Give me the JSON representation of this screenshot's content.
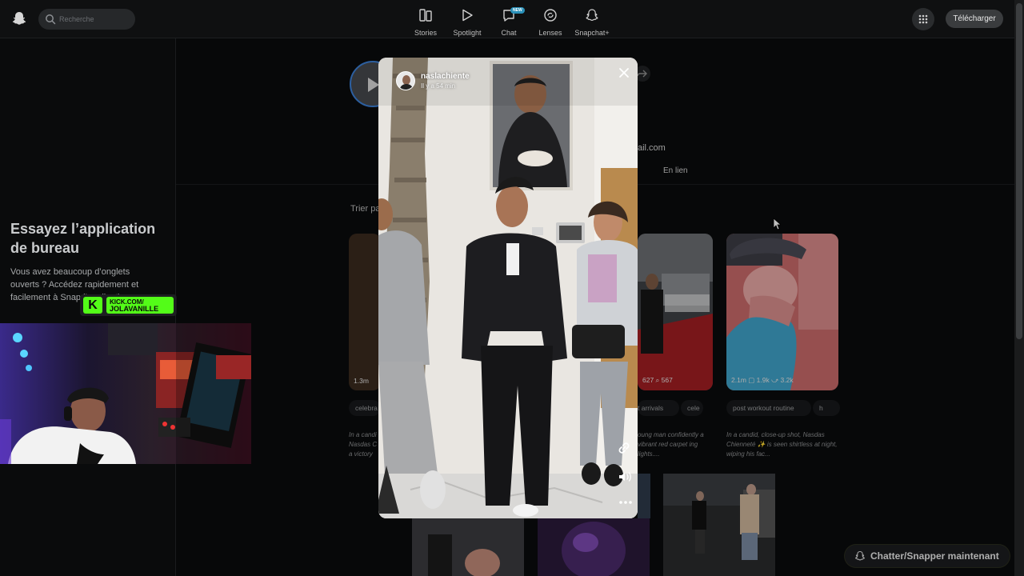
{
  "topbar": {
    "logo_icon": "snapchat-ghost-icon",
    "search_placeholder": "Recherche",
    "nav": [
      {
        "label": "Stories",
        "icon": "stories-icon"
      },
      {
        "label": "Spotlight",
        "icon": "play-icon"
      },
      {
        "label": "Chat",
        "icon": "chat-icon",
        "badge": "NEW"
      },
      {
        "label": "Lenses",
        "icon": "lenses-icon"
      },
      {
        "label": "Snapchat+",
        "icon": "snapchat-plus-icon"
      }
    ],
    "apps_icon": "grid-icon",
    "download_label": "Télécharger"
  },
  "sidebar": {
    "promo_title": "Essayez l’application de bureau",
    "promo_text": "Vous avez beaucoup d’onglets ouverts ? Accédez rapidement et facilement à Snap l’application."
  },
  "stream_overlay": {
    "kick_line1": "KICK.COM/",
    "kick_line2": "JOLAVANILLE"
  },
  "profile": {
    "email_fragment": "ail.com",
    "tab_online": "En lien",
    "sort_label": "Trier pa"
  },
  "cards": [
    {
      "stats": "1.3m",
      "chip": "celebra",
      "desc": "In a candi Nasdas C a victory"
    },
    {
      "stats": "627  ⌕ 567",
      "chip": "t arrivals",
      "chip2": "cele",
      "desc": "oung man confidently a vibrant red carpet ing lights...."
    },
    {
      "stats": "2.1m  ▢ 1.9k  ⤻ 3.2k",
      "chip": "post workout routine",
      "chip2": "h",
      "desc": "In a candid, close-up shot, Nasdas Chienneté ✨ is seen shirtless at night, wiping his fac..."
    }
  ],
  "story": {
    "username": "naslachiente",
    "time_ago": "Il y a 54 min",
    "close_icon": "close-icon",
    "link_icon": "link-icon",
    "sound_icon": "speaker-icon",
    "more_icon": "more-icon"
  },
  "chat_cta": "Chatter/Snapper maintenant",
  "colors": {
    "accent_blue": "#2a90b8",
    "kick_green": "#53fc18",
    "avatar_ring": "#3b7fd6"
  }
}
